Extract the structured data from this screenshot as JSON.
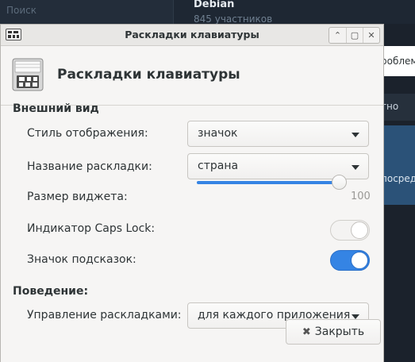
{
  "background": {
    "search_placeholder": "Поиск",
    "chat_title": "Debian",
    "chat_subtitle": "845 участников",
    "snippet1": "роблем",
    "snippet2": "тно",
    "snippet3": "посред"
  },
  "window": {
    "title": "Раскладки клавиатуры",
    "buttons": {
      "up": "⌃",
      "max": "▢",
      "close": "✕"
    }
  },
  "header": {
    "title": "Раскладки клавиатуры"
  },
  "appearance": {
    "section": "Внешний вид",
    "style_label": "Стиль отображения:",
    "style_value": "значок",
    "name_label": "Название раскладки:",
    "name_value": "страна",
    "size_label": "Размер виджета:",
    "size_value": "100",
    "caps_label": "Индикатор Caps Lock:",
    "caps_on": false,
    "tooltip_label": "Значок подсказок:",
    "tooltip_on": true
  },
  "behavior": {
    "section": "Поведение:",
    "manage_label": "Управление раскладками:",
    "manage_value": "для каждого приложения"
  },
  "footer": {
    "close_label": "Закрыть",
    "close_icon": "close-icon"
  },
  "colors": {
    "accent": "#3584e4",
    "dialog_bg": "#f6f5f4"
  }
}
